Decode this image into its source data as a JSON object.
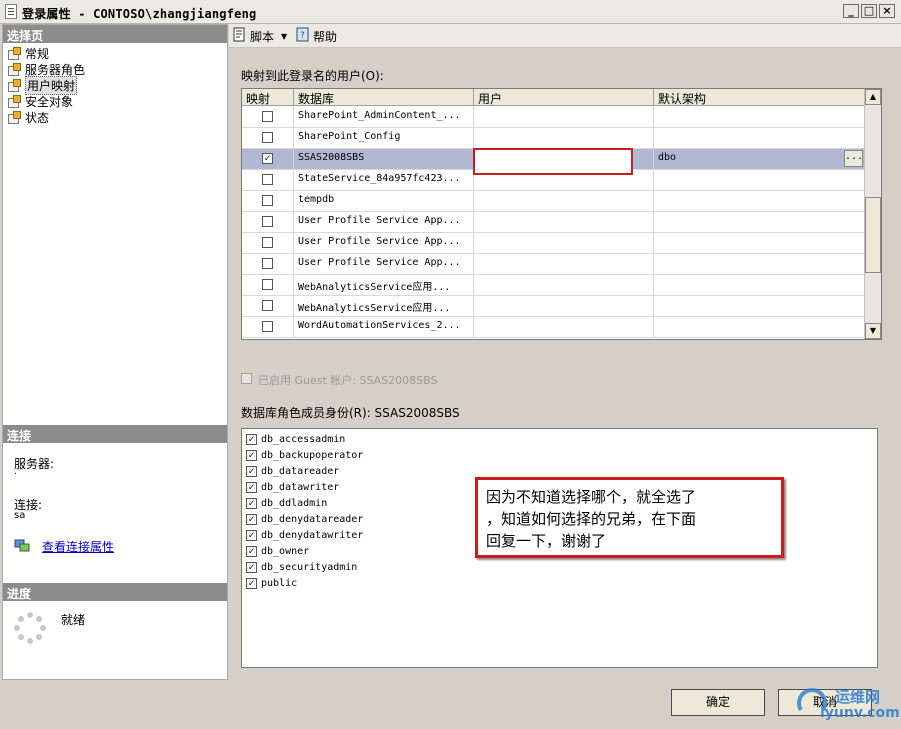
{
  "window": {
    "title": "登录属性 - CONTOSO\\zhangjiangfeng",
    "minimize": "_",
    "maximize": "□",
    "close": "×"
  },
  "left_panel": {
    "select_page_header": "选择页",
    "pages": [
      {
        "label": "常规"
      },
      {
        "label": "服务器角色"
      },
      {
        "label": "用户映射"
      },
      {
        "label": "安全对象"
      },
      {
        "label": "状态"
      }
    ],
    "selected_page": "用户映射",
    "connection_header": "连接",
    "server_label": "服务器:",
    "server_value": ".",
    "connection_label": "连接:",
    "connection_value": "sa",
    "view_connection_link": "查看连接属性",
    "progress_header": "进度",
    "progress_status": "就绪"
  },
  "toolbar": {
    "script_label": "脚本",
    "help_label": "帮助"
  },
  "user_map": {
    "title": "映射到此登录名的用户(O):",
    "columns": [
      "映射",
      "数据库",
      "用户",
      "默认架构"
    ],
    "rows": [
      {
        "mapped": false,
        "database": "SharePoint_AdminContent_...",
        "user": "",
        "schema": ""
      },
      {
        "mapped": false,
        "database": "SharePoint_Config",
        "user": "",
        "schema": ""
      },
      {
        "mapped": true,
        "database": "SSAS2008SBS",
        "user": "",
        "schema": "dbo"
      },
      {
        "mapped": false,
        "database": "StateService_84a957fc423...",
        "user": "",
        "schema": ""
      },
      {
        "mapped": false,
        "database": "tempdb",
        "user": "",
        "schema": ""
      },
      {
        "mapped": false,
        "database": "User Profile Service App...",
        "user": "",
        "schema": ""
      },
      {
        "mapped": false,
        "database": "User Profile Service App...",
        "user": "",
        "schema": ""
      },
      {
        "mapped": false,
        "database": "User Profile Service App...",
        "user": "",
        "schema": ""
      },
      {
        "mapped": false,
        "database": "WebAnalyticsService应用...",
        "user": "",
        "schema": ""
      },
      {
        "mapped": false,
        "database": "WebAnalyticsService应用...",
        "user": "",
        "schema": ""
      },
      {
        "mapped": false,
        "database": "WordAutomationServices_2...",
        "user": "",
        "schema": ""
      }
    ],
    "ellipsis": "..."
  },
  "guest": {
    "label": "已启用 Guest 帐户: SSAS2008SBS"
  },
  "roles": {
    "title": "数据库角色成员身份(R): SSAS2008SBS",
    "items": [
      {
        "name": "db_accessadmin",
        "checked": true
      },
      {
        "name": "db_backupoperator",
        "checked": true
      },
      {
        "name": "db_datareader",
        "checked": true
      },
      {
        "name": "db_datawriter",
        "checked": true
      },
      {
        "name": "db_ddladmin",
        "checked": true
      },
      {
        "name": "db_denydatareader",
        "checked": true
      },
      {
        "name": "db_denydatawriter",
        "checked": true
      },
      {
        "name": "db_owner",
        "checked": true
      },
      {
        "name": "db_securityadmin",
        "checked": true
      },
      {
        "name": "public",
        "checked": true
      }
    ]
  },
  "annotation": {
    "line1": "因为不知道选择哪个，就全选了",
    "line2": "，知道如何选择的兄弟，在下面",
    "line3": "回复一下，谢谢了"
  },
  "buttons": {
    "ok": "确定",
    "cancel": "取消"
  },
  "watermark": {
    "text1": "运维网",
    "text2": "iyunv.com"
  },
  "colors": {
    "window_bg": "#d4d0c8",
    "section_header": "#8c8c8c",
    "selected_row": "#b1b9d2",
    "annotation_border": "#d21a1a",
    "link": "#0000cc"
  }
}
